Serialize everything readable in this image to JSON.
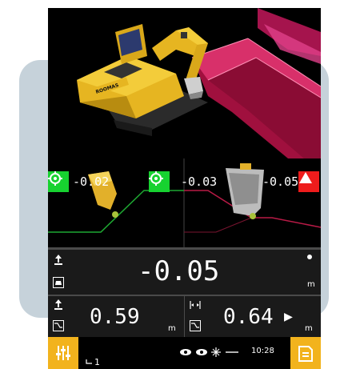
{
  "scene": {
    "machine_brand": "ROOMAS"
  },
  "views": {
    "left_value": "-0.02",
    "center_value": "-0.03",
    "right_value": "-0.05"
  },
  "readings": {
    "main_value": "-0.05",
    "main_unit": "m",
    "left_value": "0.59",
    "left_unit": "m",
    "right_value": "0.64",
    "right_unit": "m",
    "right_arrow": "▶"
  },
  "status_bar": {
    "time": "10:28",
    "counter": "1"
  },
  "colors": {
    "accent_yellow": "#f2b31d",
    "ok_green": "#17d230",
    "alert_red": "#ee1c1c",
    "design_surface": "#c2184e"
  }
}
